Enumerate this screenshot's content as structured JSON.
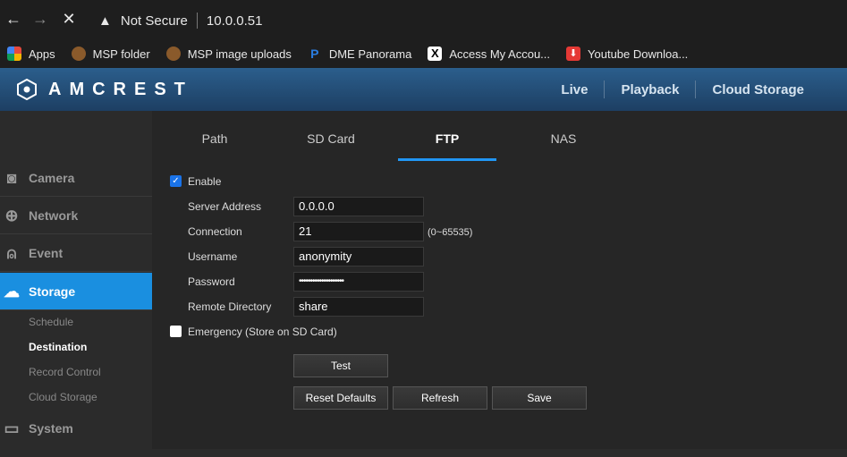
{
  "browser": {
    "back_glyph": "←",
    "forward_glyph": "→",
    "stop_glyph": "✕",
    "warning_glyph": "▲",
    "security_label": "Not Secure",
    "url": "10.0.0.51"
  },
  "bookmarks": [
    {
      "label": "Apps",
      "icon": "apps-grid-icon",
      "color": "#e5483d"
    },
    {
      "label": "MSP folder",
      "icon": "msp-icon",
      "color": "#8a5a2b"
    },
    {
      "label": "MSP image uploads",
      "icon": "msp-icon",
      "color": "#8a5a2b"
    },
    {
      "label": "DME Panorama",
      "icon": "panorama-icon",
      "color": "#2a7de1"
    },
    {
      "label": "Access My Accou...",
      "icon": "x-icon",
      "color": "#ffffff"
    },
    {
      "label": "Youtube Downloa...",
      "icon": "download-icon",
      "color": "#e53935"
    }
  ],
  "header": {
    "logo_text": "AMCREST",
    "nav": [
      {
        "label": "Live"
      },
      {
        "label": "Playback"
      },
      {
        "label": "Cloud Storage"
      }
    ]
  },
  "sidebar": {
    "items": [
      {
        "label": "Camera",
        "icon": "camera-icon",
        "glyph": "◙"
      },
      {
        "label": "Network",
        "icon": "network-globe-icon",
        "glyph": "⊕"
      },
      {
        "label": "Event",
        "icon": "event-alarm-icon",
        "glyph": "⍝"
      },
      {
        "label": "Storage",
        "icon": "cloud-storage-icon",
        "glyph": "☁"
      },
      {
        "label": "System",
        "icon": "system-monitor-icon",
        "glyph": "▭"
      }
    ],
    "sub_items": [
      {
        "label": "Schedule"
      },
      {
        "label": "Destination"
      },
      {
        "label": "Record Control"
      },
      {
        "label": "Cloud Storage"
      }
    ]
  },
  "tabs": [
    {
      "label": "Path"
    },
    {
      "label": "SD Card"
    },
    {
      "label": "FTP"
    },
    {
      "label": "NAS"
    }
  ],
  "form": {
    "enable_label": "Enable",
    "enable_checked": true,
    "server_address_label": "Server Address",
    "server_address_value": "0.0.0.0",
    "connection_label": "Connection",
    "connection_value": "21",
    "connection_range": "(0~65535)",
    "username_label": "Username",
    "username_value": "anonymity",
    "password_label": "Password",
    "password_value": "••••••••••••••••••••",
    "remote_dir_label": "Remote Directory",
    "remote_dir_value": "share",
    "emergency_label": "Emergency (Store on SD Card)",
    "emergency_checked": false
  },
  "buttons": {
    "test": "Test",
    "reset_defaults": "Reset Defaults",
    "refresh": "Refresh",
    "save": "Save"
  },
  "colors": {
    "accent": "#1a8fe0",
    "tab_underline": "#2196f3",
    "header_top": "#2b5e8c"
  }
}
